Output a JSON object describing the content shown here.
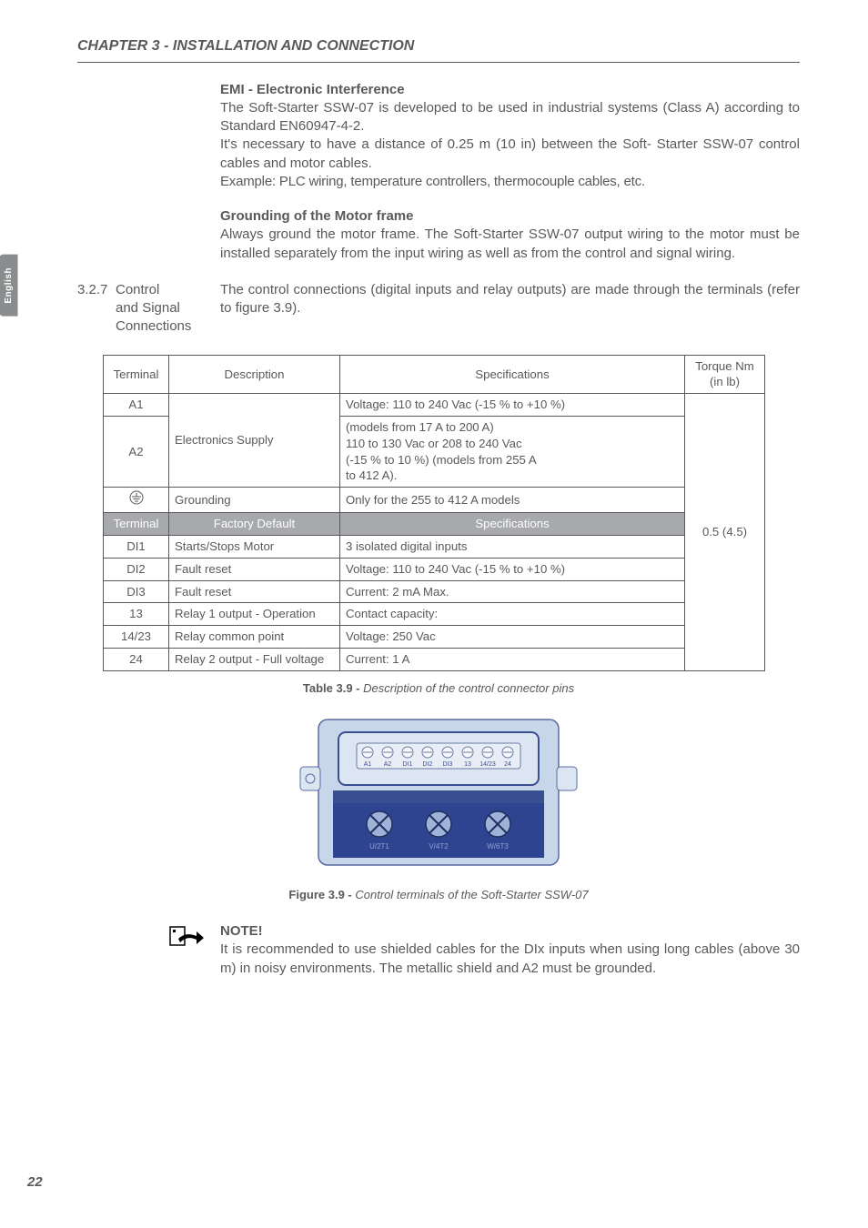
{
  "chapter_title": "CHAPTER 3 - INSTALLATION AND CONNECTION",
  "lang_tab": "English",
  "page_number": "22",
  "emi": {
    "heading": "EMI - Electronic Interference",
    "p1": "The Soft-Starter SSW-07 is developed to be used in industrial systems (Class A) according to Standard EN60947-4-2.",
    "p2": "It's necessary to have a distance of 0.25 m (10 in) between the Soft- Starter SSW-07 control cables and motor cables.",
    "p3": "Example: PLC wiring, temperature controllers, thermocouple cables, etc."
  },
  "ground": {
    "heading": "Grounding of the Motor frame",
    "p1": "Always ground the motor frame. The Soft-Starter SSW-07 output wiring to the motor must be installed separately from the input wiring as well as from the control and signal wiring."
  },
  "section": {
    "num": "3.2.7",
    "label_l1": "Control",
    "label_l2": "and Signal",
    "label_l3": "Connections",
    "body": "The control connections (digital inputs and relay outputs) are made through the terminals (refer to figure 3.9)."
  },
  "table": {
    "head": {
      "terminal": "Terminal",
      "description": "Description",
      "specs": "Specifications",
      "torque_l1": "Torque Nm",
      "torque_l2": "(in lb)"
    },
    "r1": {
      "term": "A1"
    },
    "r2": {
      "term": "A2",
      "desc": "Electronics Supply",
      "spec_l1": "Voltage: 110 to 240 Vac (-15 % to +10 %)",
      "spec_l2": "(models from 17 A to 200 A)",
      "spec_l3": "110 to 130 Vac or 208 to 240 Vac",
      "spec_l4": "(-15 % to 10 %) (models from 255 A",
      "spec_l5": "to 412 A)."
    },
    "r3": {
      "desc": "Grounding",
      "spec": "Only for the 255 to 412 A models"
    },
    "sub": {
      "terminal": "Terminal",
      "factory": "Factory Default",
      "specs": "Specifications"
    },
    "r4": {
      "term": "DI1",
      "desc": "Starts/Stops Motor",
      "spec": "3 isolated digital inputs"
    },
    "r5": {
      "term": "DI2",
      "desc": "Fault reset",
      "spec": "Voltage: 110 to 240 Vac (-15 % to +10 %)"
    },
    "r6": {
      "term": "DI3",
      "desc": "Fault reset",
      "spec": "Current: 2 mA Max."
    },
    "r7": {
      "term": "13",
      "desc": "Relay 1 output - Operation",
      "spec": "Contact capacity:"
    },
    "r8": {
      "term": "14/23",
      "desc": "Relay common point",
      "spec": "Voltage: 250 Vac"
    },
    "r9": {
      "term": "24",
      "desc": "Relay 2 output - Full voltage",
      "spec": "Current: 1 A"
    },
    "torque": "0.5 (4.5)"
  },
  "table_caption": {
    "bold": "Table 3.9 - ",
    "it": "Description of the control connector pins"
  },
  "fig": {
    "terminals": [
      "A1",
      "A2",
      "DI1",
      "DI2",
      "DI3",
      "13",
      "14/23",
      "24"
    ],
    "bottom": [
      "U/2T1",
      "V/4T2",
      "W/6T3"
    ]
  },
  "fig_caption": {
    "bold": "Figure 3.9 - ",
    "it": "Control terminals of the Soft-Starter SSW-07"
  },
  "note": {
    "heading": "NOTE!",
    "body": "It is recommended to use shielded cables for the DIx inputs when using long cables (above 30 m) in noisy environments. The metallic shield and A2 must be grounded."
  },
  "chart_data": [
    {
      "type": "table",
      "title": "Description of the control connector pins",
      "columns": [
        "Terminal",
        "Description/Factory Default",
        "Specifications",
        "Torque Nm (in lb)"
      ],
      "rows": [
        [
          "A1",
          "Electronics Supply",
          "Voltage: 110 to 240 Vac (-15 % to +10 %)",
          "0.5 (4.5)"
        ],
        [
          "A2",
          "Electronics Supply",
          "(models from 17 A to 200 A) 110 to 130 Vac or 208 to 240 Vac (-15 % to 10 %) (models from 255 A to 412 A).",
          "0.5 (4.5)"
        ],
        [
          "(ground)",
          "Grounding",
          "Only for the 255 to 412 A models",
          "0.5 (4.5)"
        ],
        [
          "DI1",
          "Starts/Stops Motor",
          "3 isolated digital inputs",
          "0.5 (4.5)"
        ],
        [
          "DI2",
          "Fault reset",
          "Voltage: 110 to 240 Vac (-15 % to +10 %)",
          "0.5 (4.5)"
        ],
        [
          "DI3",
          "Fault reset",
          "Current: 2 mA Max.",
          "0.5 (4.5)"
        ],
        [
          "13",
          "Relay 1 output - Operation",
          "Contact capacity:",
          "0.5 (4.5)"
        ],
        [
          "14/23",
          "Relay common point",
          "Voltage: 250 Vac",
          "0.5 (4.5)"
        ],
        [
          "24",
          "Relay 2 output - Full voltage",
          "Current: 1 A",
          "0.5 (4.5)"
        ]
      ]
    }
  ]
}
